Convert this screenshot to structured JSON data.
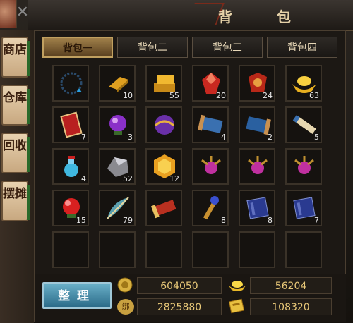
{
  "window": {
    "title": "背 包",
    "close_symbol": "✕"
  },
  "side_tabs": [
    {
      "label": "商店"
    },
    {
      "label": "仓库"
    },
    {
      "label": "回收"
    },
    {
      "label": "摆摊"
    }
  ],
  "tabs": [
    {
      "label": "背包一",
      "active": true
    },
    {
      "label": "背包二",
      "active": false
    },
    {
      "label": "背包三",
      "active": false
    },
    {
      "label": "背包四",
      "active": false
    }
  ],
  "slots": [
    {
      "icon": "necklace-icon",
      "count": ""
    },
    {
      "icon": "gold-bar-icon",
      "count": "10"
    },
    {
      "icon": "gold-bars-stack-icon",
      "count": "55"
    },
    {
      "icon": "red-gem-icon",
      "count": "20"
    },
    {
      "icon": "red-armor-icon",
      "count": "24"
    },
    {
      "icon": "gold-ingot-icon",
      "count": "63"
    },
    {
      "icon": "red-card-icon",
      "count": "7"
    },
    {
      "icon": "purple-orb-icon",
      "count": "3"
    },
    {
      "icon": "purple-orb-gold-icon",
      "count": ""
    },
    {
      "icon": "scroll-icon",
      "count": "4"
    },
    {
      "icon": "scroll-blue-icon",
      "count": "2"
    },
    {
      "icon": "rolled-scroll-icon",
      "count": "5"
    },
    {
      "icon": "blue-potion-icon",
      "count": "4"
    },
    {
      "icon": "silver-ore-icon",
      "count": "52"
    },
    {
      "icon": "gold-hexagon-icon",
      "count": "12"
    },
    {
      "icon": "purple-orb-claw-icon",
      "count": ""
    },
    {
      "icon": "purple-orb-claw-icon",
      "count": ""
    },
    {
      "icon": "purple-orb-claw-icon",
      "count": ""
    },
    {
      "icon": "red-orb-icon",
      "count": "15"
    },
    {
      "icon": "feather-icon",
      "count": "79"
    },
    {
      "icon": "red-scroll-icon",
      "count": ""
    },
    {
      "icon": "gold-staff-icon",
      "count": "8"
    },
    {
      "icon": "blue-book-icon",
      "count": "8"
    },
    {
      "icon": "blue-book-icon",
      "count": "7"
    },
    {
      "icon": "empty-slot",
      "count": ""
    },
    {
      "icon": "empty-slot",
      "count": ""
    },
    {
      "icon": "empty-slot",
      "count": ""
    },
    {
      "icon": "empty-slot",
      "count": ""
    },
    {
      "icon": "empty-slot",
      "count": ""
    },
    {
      "icon": "empty-slot",
      "count": ""
    }
  ],
  "sort_button": {
    "label": "整理"
  },
  "currency": {
    "gold": "604050",
    "ingot": "56204",
    "bound_gold_symbol": "绑",
    "bound_gold": "2825880",
    "voucher": "108320"
  }
}
